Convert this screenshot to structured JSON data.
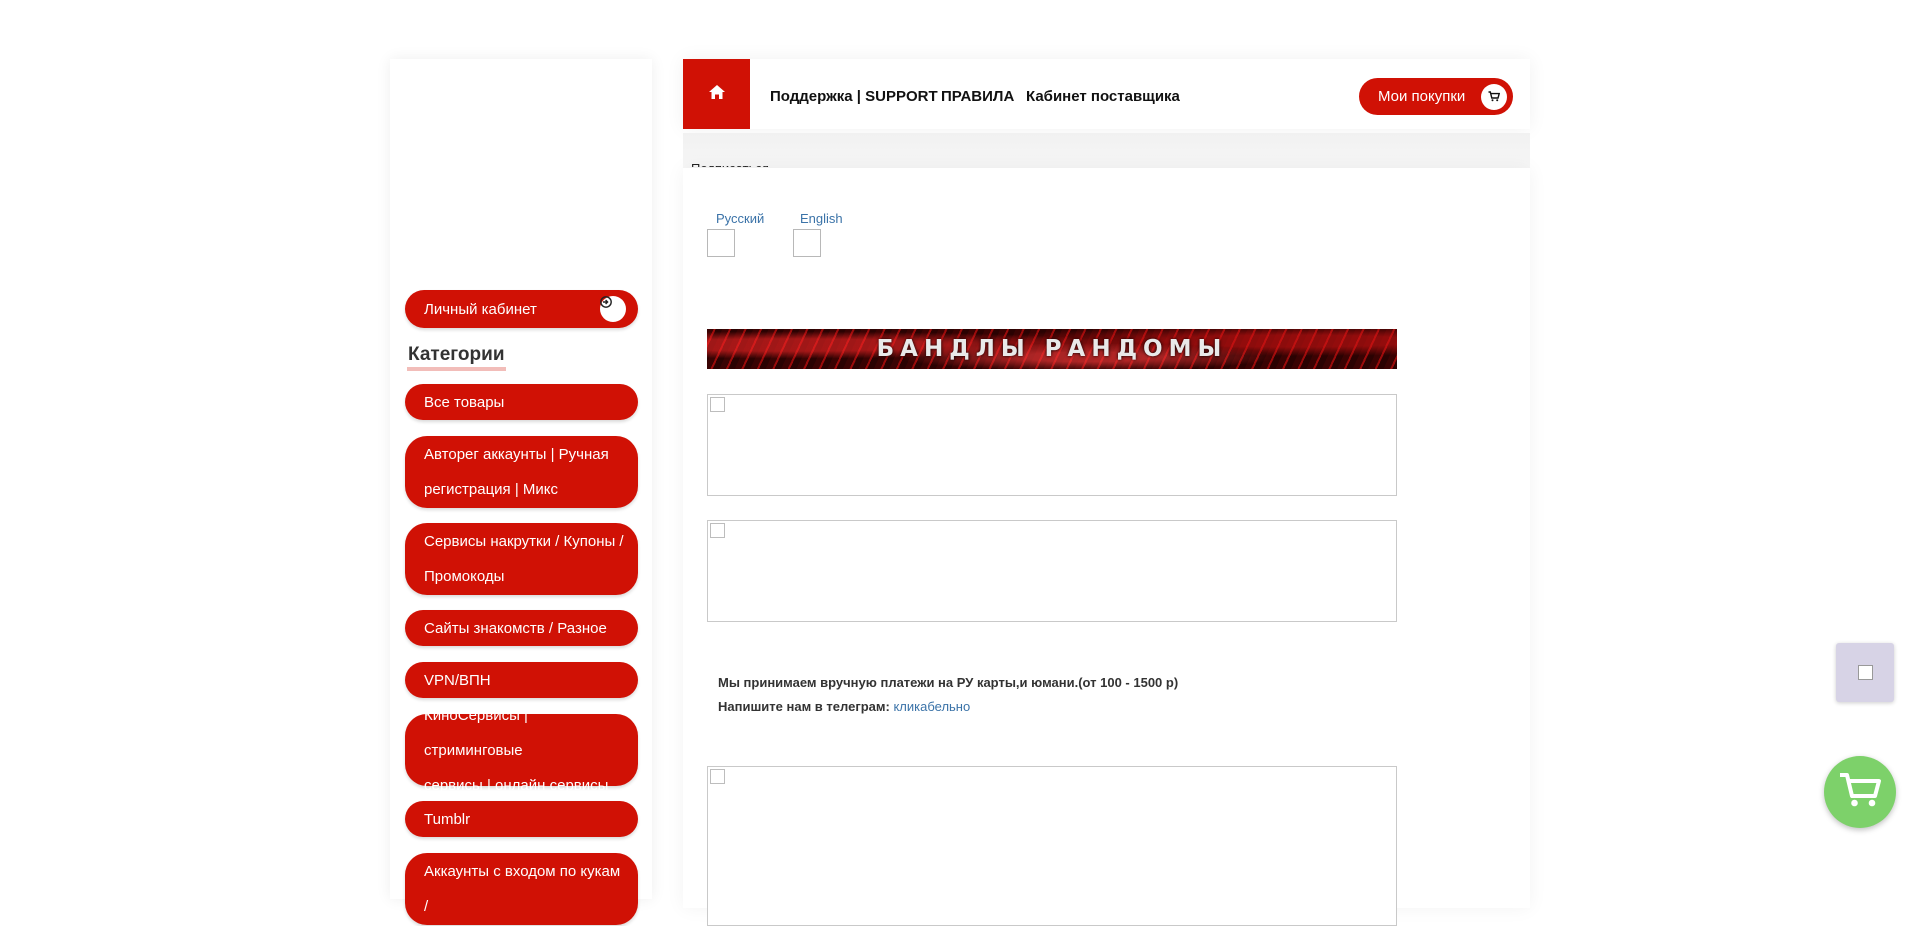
{
  "header": {
    "nav": [
      {
        "label": "Поддержка | SUPPORT"
      },
      {
        "label": "ПРАВИЛА"
      },
      {
        "label": "Кабинет поставщика"
      }
    ],
    "purchases_label": "Мои покупки"
  },
  "strip": {
    "text": "Подписаться"
  },
  "sidebar": {
    "account_label": "Личный кабинет",
    "categories_title": "Категории",
    "categories": [
      {
        "label": "Все товары"
      },
      {
        "line1": "Авторег аккаунты | Ручная",
        "line2": "регистрация | Микс"
      },
      {
        "line1": "Сервисы накрутки / Купоны /",
        "line2": "Промокоды"
      },
      {
        "label": "Сайты знакомств / Разное"
      },
      {
        "label": "VPN/ВПН"
      },
      {
        "line1": "КиноСервисы | стриминговые",
        "line2": "сервисы | онлайн сервисы"
      },
      {
        "label": "Tumblr"
      },
      {
        "line1": "Аккаунты с входом по кукам /",
        "line2": ""
      }
    ]
  },
  "content": {
    "languages": [
      {
        "label": "Русский"
      },
      {
        "label": "English"
      }
    ],
    "banner_text": "БАНДЛЫ  РАНДОМЫ",
    "info_line1": "Мы принимаем вручную платежи на РУ карты,и юмани.(от 100 - 1500 р)",
    "info_line2_prefix": "Напишите нам в телеграм: ",
    "info_link": "кликабельно"
  },
  "colors": {
    "accent": "#d01105",
    "link": "#3b73a8",
    "cart_fab": "#7dd16a",
    "chat_widget": "#d7d3e6"
  },
  "icons": [
    "home-icon",
    "login-icon",
    "cart-icon",
    "broken-image-icon"
  ]
}
